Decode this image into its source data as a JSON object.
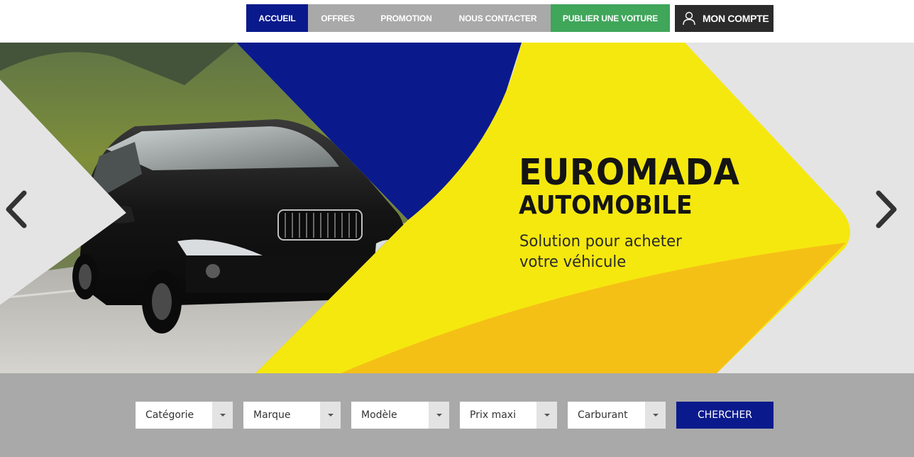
{
  "nav": {
    "items": [
      {
        "label": "ACCUEIL"
      },
      {
        "label": "OFFRES"
      },
      {
        "label": "PROMOTION"
      },
      {
        "label": "NOUS CONTACTER"
      },
      {
        "label": "PUBLIER UNE VOITURE"
      }
    ],
    "account": {
      "label": "MON COMPTE",
      "icon": "user-icon"
    }
  },
  "hero": {
    "brand_line1": "EUROMADA",
    "brand_line2": "AUTOMOBILE",
    "tagline_line1": "Solution pour acheter",
    "tagline_line2": "votre véhicule",
    "prev_icon": "chevron-left-icon",
    "next_icon": "chevron-right-icon"
  },
  "search": {
    "filters": [
      {
        "value": "Catégorie"
      },
      {
        "value": "Marque"
      },
      {
        "value": "Modèle"
      },
      {
        "value": "Prix maxi"
      },
      {
        "value": "Carburant"
      }
    ],
    "submit_label": "CHERCHER"
  },
  "colors": {
    "accent_blue": "#0a1a8c",
    "green": "#3fa65a",
    "yellow": "#f5e80f",
    "orange": "#f5c016",
    "gray": "#a9a9a9"
  }
}
